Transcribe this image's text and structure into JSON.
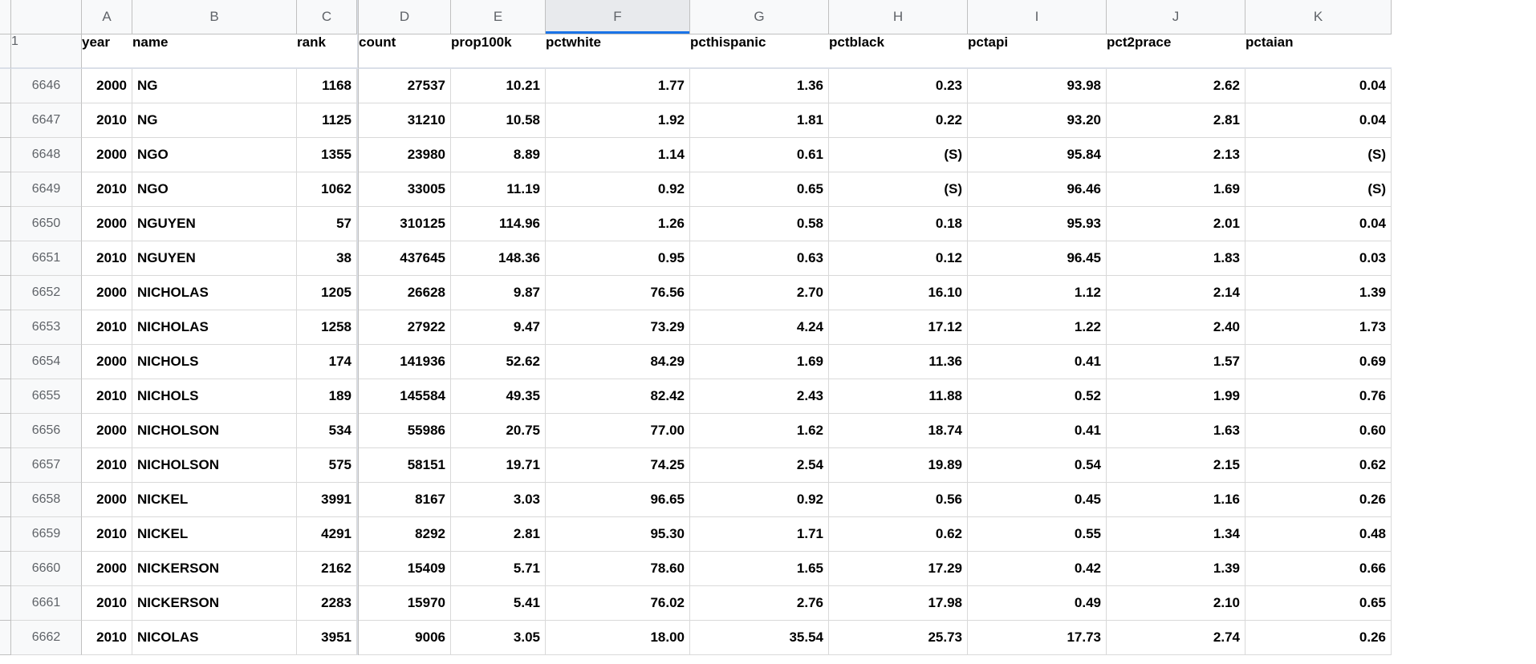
{
  "columns": [
    "A",
    "B",
    "C",
    "D",
    "E",
    "F",
    "G",
    "H",
    "I",
    "J",
    "K"
  ],
  "selectedColumn": "F",
  "frozenHeaderRow": "1",
  "headers": {
    "A": "year",
    "B": "name",
    "C": "rank",
    "D": "count",
    "E": "prop100k",
    "F": "pctwhite",
    "G": "pcthispanic",
    "H": "pctblack",
    "I": "pctapi",
    "J": "pct2prace",
    "K": "pctaian"
  },
  "alignments": {
    "A": "r",
    "B": "l",
    "C": "r",
    "D": "r",
    "E": "r",
    "F": "r",
    "G": "r",
    "H": "r",
    "I": "r",
    "J": "r",
    "K": "r"
  },
  "rows": [
    {
      "n": "6646",
      "c": {
        "A": "2000",
        "B": "NG",
        "C": "1168",
        "D": "27537",
        "E": "10.21",
        "F": "1.77",
        "G": "1.36",
        "H": "0.23",
        "I": "93.98",
        "J": "2.62",
        "K": "0.04"
      }
    },
    {
      "n": "6647",
      "c": {
        "A": "2010",
        "B": "NG",
        "C": "1125",
        "D": "31210",
        "E": "10.58",
        "F": "1.92",
        "G": "1.81",
        "H": "0.22",
        "I": "93.20",
        "J": "2.81",
        "K": "0.04"
      }
    },
    {
      "n": "6648",
      "c": {
        "A": "2000",
        "B": "NGO",
        "C": "1355",
        "D": "23980",
        "E": "8.89",
        "F": "1.14",
        "G": "0.61",
        "H": "(S)",
        "I": "95.84",
        "J": "2.13",
        "K": "(S)"
      }
    },
    {
      "n": "6649",
      "c": {
        "A": "2010",
        "B": "NGO",
        "C": "1062",
        "D": "33005",
        "E": "11.19",
        "F": "0.92",
        "G": "0.65",
        "H": "(S)",
        "I": "96.46",
        "J": "1.69",
        "K": "(S)"
      }
    },
    {
      "n": "6650",
      "c": {
        "A": "2000",
        "B": "NGUYEN",
        "C": "57",
        "D": "310125",
        "E": "114.96",
        "F": "1.26",
        "G": "0.58",
        "H": "0.18",
        "I": "95.93",
        "J": "2.01",
        "K": "0.04"
      }
    },
    {
      "n": "6651",
      "c": {
        "A": "2010",
        "B": "NGUYEN",
        "C": "38",
        "D": "437645",
        "E": "148.36",
        "F": "0.95",
        "G": "0.63",
        "H": "0.12",
        "I": "96.45",
        "J": "1.83",
        "K": "0.03"
      }
    },
    {
      "n": "6652",
      "c": {
        "A": "2000",
        "B": "NICHOLAS",
        "C": "1205",
        "D": "26628",
        "E": "9.87",
        "F": "76.56",
        "G": "2.70",
        "H": "16.10",
        "I": "1.12",
        "J": "2.14",
        "K": "1.39"
      }
    },
    {
      "n": "6653",
      "c": {
        "A": "2010",
        "B": "NICHOLAS",
        "C": "1258",
        "D": "27922",
        "E": "9.47",
        "F": "73.29",
        "G": "4.24",
        "H": "17.12",
        "I": "1.22",
        "J": "2.40",
        "K": "1.73"
      }
    },
    {
      "n": "6654",
      "c": {
        "A": "2000",
        "B": "NICHOLS",
        "C": "174",
        "D": "141936",
        "E": "52.62",
        "F": "84.29",
        "G": "1.69",
        "H": "11.36",
        "I": "0.41",
        "J": "1.57",
        "K": "0.69"
      }
    },
    {
      "n": "6655",
      "c": {
        "A": "2010",
        "B": "NICHOLS",
        "C": "189",
        "D": "145584",
        "E": "49.35",
        "F": "82.42",
        "G": "2.43",
        "H": "11.88",
        "I": "0.52",
        "J": "1.99",
        "K": "0.76"
      }
    },
    {
      "n": "6656",
      "c": {
        "A": "2000",
        "B": "NICHOLSON",
        "C": "534",
        "D": "55986",
        "E": "20.75",
        "F": "77.00",
        "G": "1.62",
        "H": "18.74",
        "I": "0.41",
        "J": "1.63",
        "K": "0.60"
      }
    },
    {
      "n": "6657",
      "c": {
        "A": "2010",
        "B": "NICHOLSON",
        "C": "575",
        "D": "58151",
        "E": "19.71",
        "F": "74.25",
        "G": "2.54",
        "H": "19.89",
        "I": "0.54",
        "J": "2.15",
        "K": "0.62"
      }
    },
    {
      "n": "6658",
      "c": {
        "A": "2000",
        "B": "NICKEL",
        "C": "3991",
        "D": "8167",
        "E": "3.03",
        "F": "96.65",
        "G": "0.92",
        "H": "0.56",
        "I": "0.45",
        "J": "1.16",
        "K": "0.26"
      }
    },
    {
      "n": "6659",
      "c": {
        "A": "2010",
        "B": "NICKEL",
        "C": "4291",
        "D": "8292",
        "E": "2.81",
        "F": "95.30",
        "G": "1.71",
        "H": "0.62",
        "I": "0.55",
        "J": "1.34",
        "K": "0.48"
      }
    },
    {
      "n": "6660",
      "c": {
        "A": "2000",
        "B": "NICKERSON",
        "C": "2162",
        "D": "15409",
        "E": "5.71",
        "F": "78.60",
        "G": "1.65",
        "H": "17.29",
        "I": "0.42",
        "J": "1.39",
        "K": "0.66"
      }
    },
    {
      "n": "6661",
      "c": {
        "A": "2010",
        "B": "NICKERSON",
        "C": "2283",
        "D": "15970",
        "E": "5.41",
        "F": "76.02",
        "G": "2.76",
        "H": "17.98",
        "I": "0.49",
        "J": "2.10",
        "K": "0.65"
      }
    },
    {
      "n": "6662",
      "c": {
        "A": "2010",
        "B": "NICOLAS",
        "C": "3951",
        "D": "9006",
        "E": "3.05",
        "F": "18.00",
        "G": "35.54",
        "H": "25.73",
        "I": "17.73",
        "J": "2.74",
        "K": "0.26"
      }
    }
  ]
}
